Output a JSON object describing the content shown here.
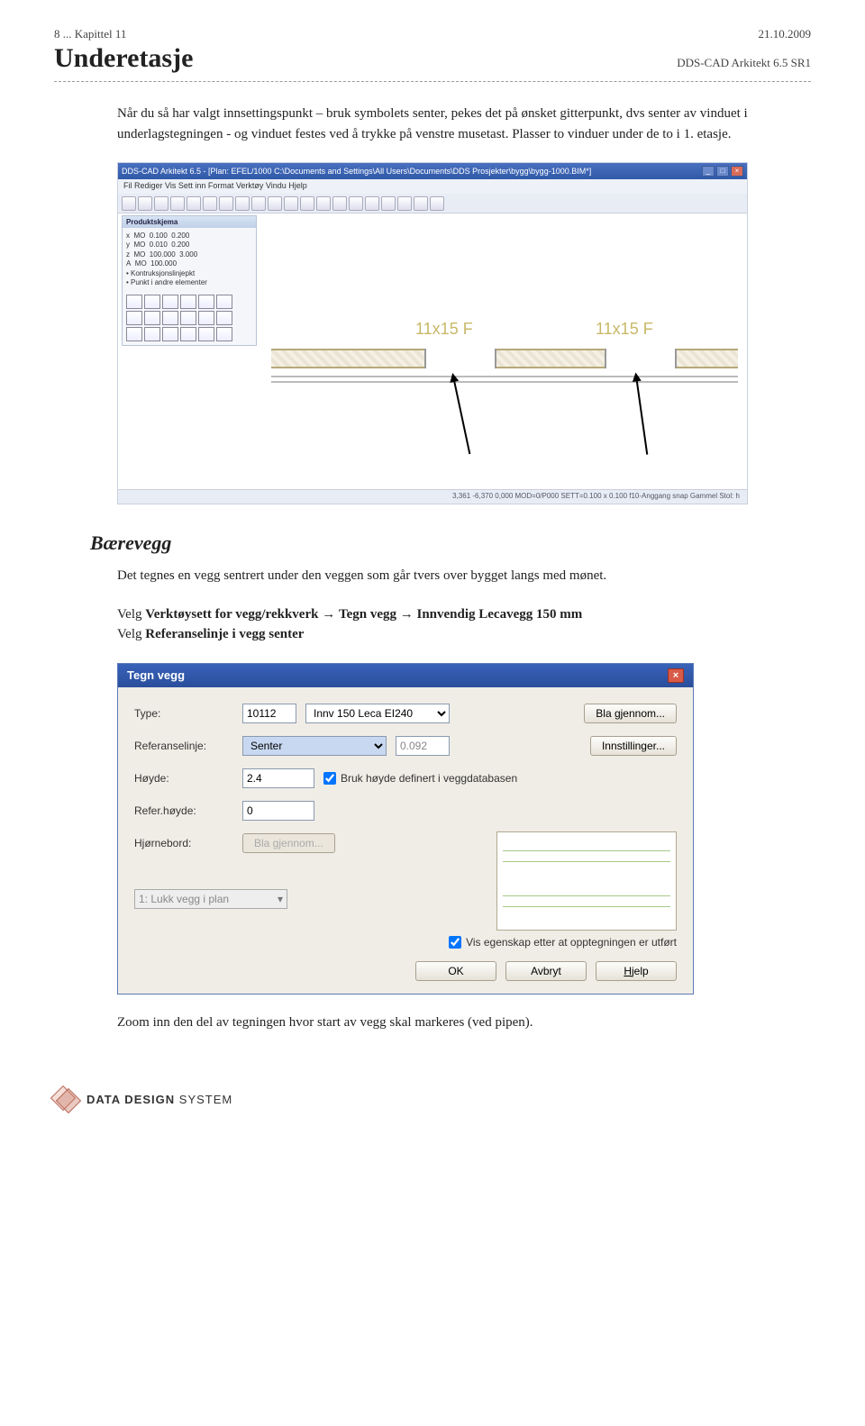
{
  "header": {
    "chapter": "8 ... Kapittel 11",
    "date": "21.10.2009",
    "title": "Underetasje",
    "version": "DDS-CAD Arkitekt  6.5 SR1"
  },
  "intro_paragraph": "Når du så har valgt innsettingspunkt – bruk symbolets senter, pekes det på ønsket gitterpunkt, dvs senter av vinduet i underlagstegningen - og vinduet festes ved å trykke på venstre musetast. Plasser to vinduer under de to i 1. etasje.",
  "screenshot1": {
    "app_title": "DDS-CAD Arkitekt 6.5 - [Plan: EFEL/1000  C:\\Documents and Settings\\All Users\\Documents\\DDS Prosjekter\\bygg\\bygg-1000.BIM*]",
    "menu": "Fil  Rediger  Vis  Sett inn  Format  Verktøy  Vindu  Hjelp",
    "palette_title": "Produktskjema",
    "dim1": "11x15 F",
    "dim2": "11x15 F",
    "status": "3,361     -6,370     0,000     MOD=0/P000     SETT=0.100 x 0.100     f10-Anggang snap     Gammel Stol: h"
  },
  "section2": {
    "heading": "Bærevegg",
    "p1": "Det tegnes en vegg sentrert under den veggen som går tvers over bygget langs med mønet.",
    "p2a": "Velg ",
    "p2b": "Verktøysett for vegg/rekkverk",
    "p2c": " → ",
    "p2d": "Tegn vegg",
    "p2e": " → ",
    "p2f": "Innvendig Lecavegg 150 mm",
    "p3a": "Velg ",
    "p3b": "Referanselinje i vegg senter"
  },
  "dialog": {
    "title": "Tegn vegg",
    "labels": {
      "type": "Type:",
      "refline": "Referanselinje:",
      "height": "Høyde:",
      "refheight": "Refer.høyde:",
      "corner": "Hjørnebord:"
    },
    "values": {
      "type_code": "10112",
      "type_name": "Innv 150 Leca EI240",
      "refline": "Senter",
      "refline_offset": "0.092",
      "height": "2.4",
      "refheight": "0",
      "corner_btn": "Bla gjennom...",
      "close_option": "1: Lukk vegg i plan"
    },
    "buttons": {
      "browse": "Bla gjennom...",
      "settings": "Innstillinger...",
      "ok": "OK",
      "cancel": "Avbryt",
      "help": "Hjelp"
    },
    "checkboxes": {
      "use_height": "Bruk høyde definert i veggdatabasen",
      "show_props": "Vis egenskap etter at opptegningen er utført"
    }
  },
  "closing_text": "Zoom inn den del av tegningen hvor start av vegg skal markeres (ved pipen).",
  "footer": {
    "brand_bold": "DATA DESIGN",
    "brand_rest": " SYSTEM"
  }
}
